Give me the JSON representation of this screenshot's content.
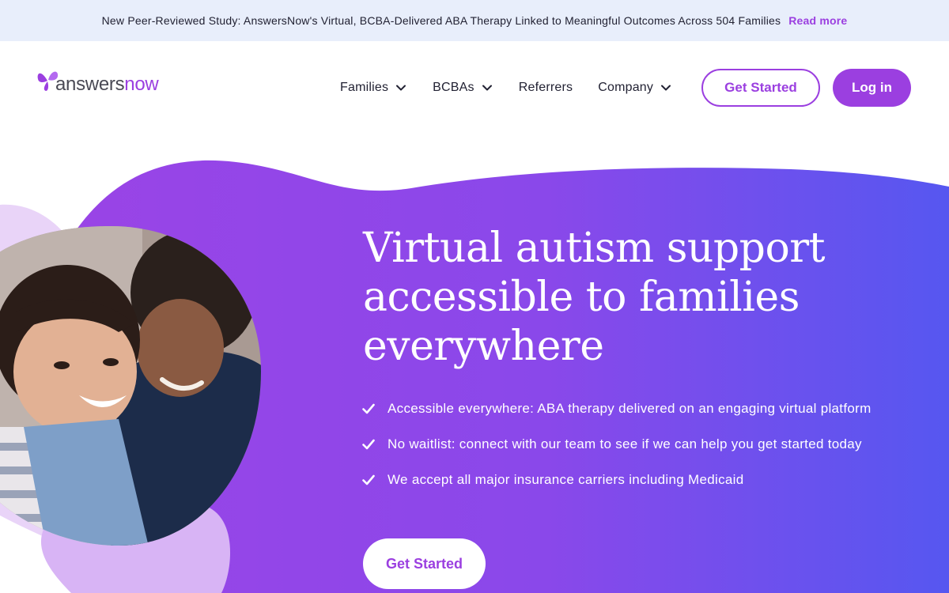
{
  "announcement": {
    "text": "New Peer-Reviewed Study: AnswersNow's Virtual, BCBA-Delivered ABA Therapy Linked to Meaningful Outcomes Across 504 Families",
    "link_label": "Read more"
  },
  "brand": {
    "name_part1": "answers",
    "name_part2": "now",
    "accent_color": "#9b3fe0",
    "gradient_start": "#9a44e6",
    "gradient_end": "#5657f0"
  },
  "nav": {
    "items": [
      {
        "label": "Families",
        "has_dropdown": true
      },
      {
        "label": "BCBAs",
        "has_dropdown": true
      },
      {
        "label": "Referrers",
        "has_dropdown": false
      },
      {
        "label": "Company",
        "has_dropdown": true
      }
    ],
    "get_started_label": "Get Started",
    "login_label": "Log in"
  },
  "hero": {
    "title": "Virtual autism support accessible to families everywhere",
    "bullets": [
      "Accessible everywhere: ABA therapy delivered on an engaging virtual platform",
      "No waitlist: connect with our team to see if we can help you get started today",
      "We accept all major insurance carriers including Medicaid"
    ],
    "cta_label": "Get Started",
    "photo_icon": "family-photo"
  }
}
